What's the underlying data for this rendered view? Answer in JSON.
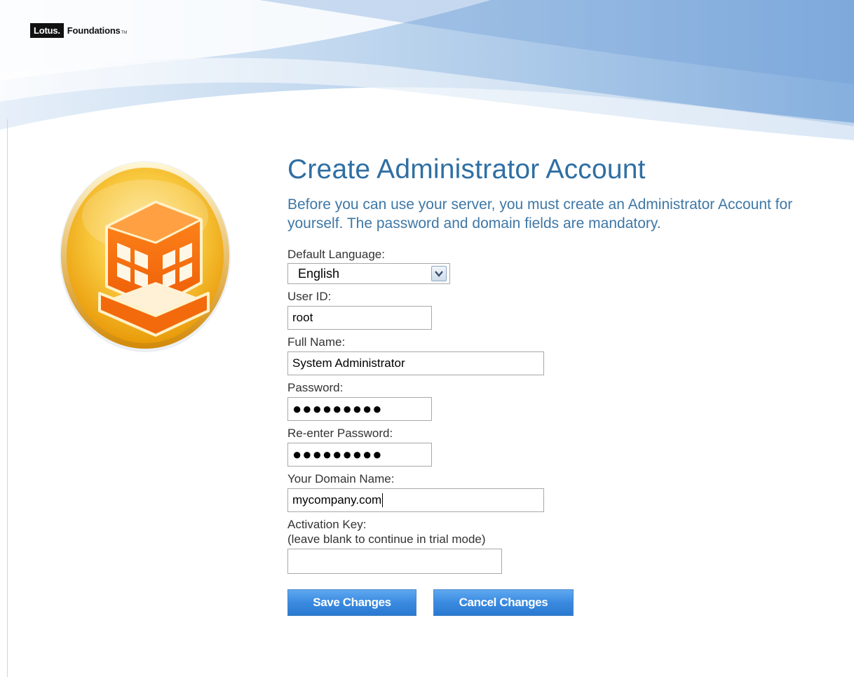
{
  "brand": {
    "lotus": "Lotus.",
    "foundations": "Foundations",
    "tm": "TM"
  },
  "page": {
    "title": "Create Administrator Account",
    "intro": "Before you can use your server, you must create an Administrator Account for yourself. The password and domain fields are mandatory."
  },
  "form": {
    "language": {
      "label": "Default Language:",
      "value": "English"
    },
    "user_id": {
      "label": "User ID:",
      "value": "root"
    },
    "full_name": {
      "label": "Full Name:",
      "value": "System Administrator"
    },
    "password": {
      "label": "Password:",
      "value": "●●●●●●●●●"
    },
    "reenter_password": {
      "label": "Re-enter Password:",
      "value": "●●●●●●●●●"
    },
    "domain": {
      "label": "Your Domain Name:",
      "value": "mycompany.com"
    },
    "activation_key": {
      "label": "Activation Key:",
      "hint": "(leave blank to continue in trial mode)",
      "value": ""
    }
  },
  "buttons": {
    "save": "Save Changes",
    "cancel": "Cancel Changes"
  },
  "colors": {
    "title": "#2f6fa3",
    "intro": "#3e77a6",
    "button": "#3a8ae0",
    "emblem_outer": "#f6b21e",
    "emblem_building": "#f26b10"
  },
  "icons": {
    "emblem": "building-icon",
    "select_arrow": "chevron-down-icon"
  }
}
